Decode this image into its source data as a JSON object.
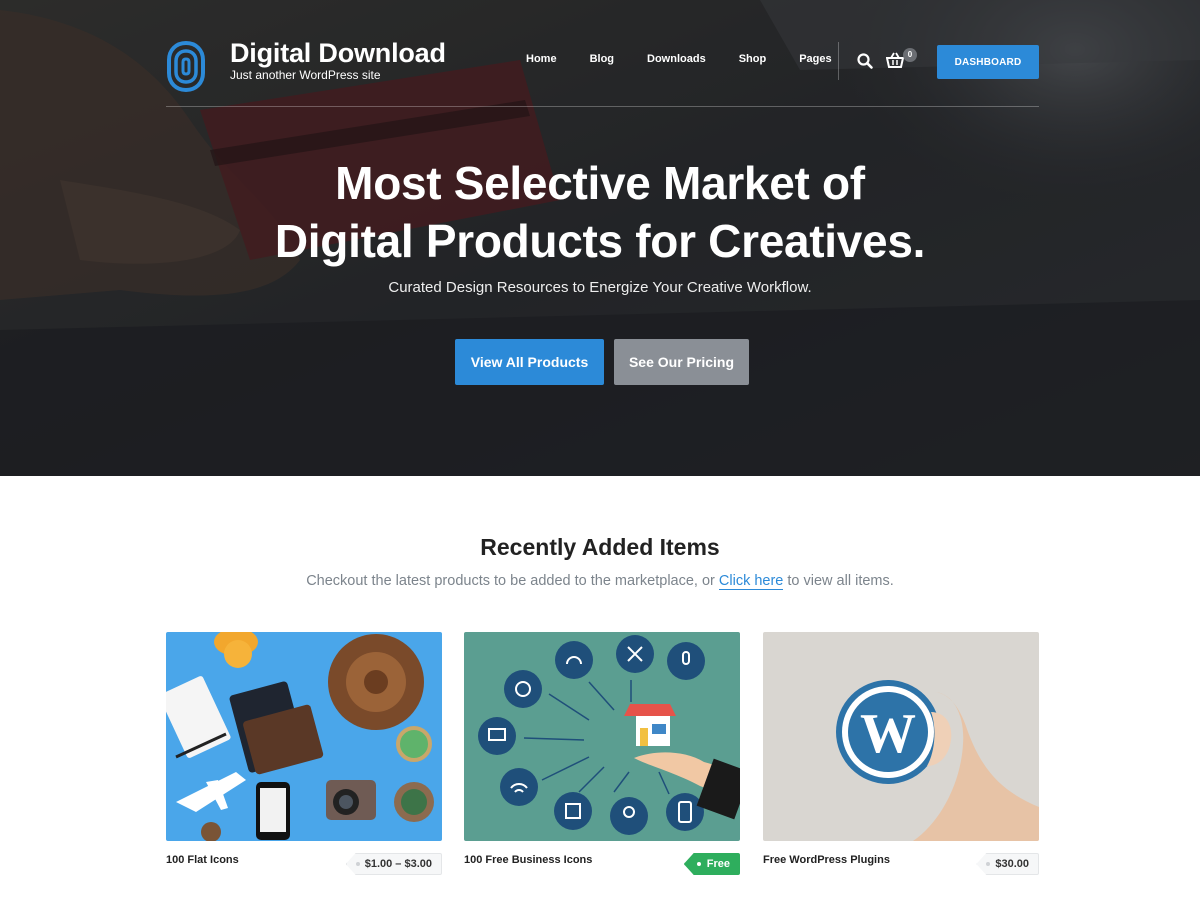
{
  "brand": {
    "title": "Digital Download",
    "tagline": "Just another WordPress site"
  },
  "nav": {
    "items": [
      {
        "label": "Home"
      },
      {
        "label": "Blog"
      },
      {
        "label": "Downloads"
      },
      {
        "label": "Shop"
      },
      {
        "label": "Pages"
      }
    ],
    "cart_count": "0",
    "dashboard_label": "DASHBOARD"
  },
  "hero": {
    "title_line1": "Most Selective Market of",
    "title_line2": "Digital Products for Creatives.",
    "subtitle": "Curated Design Resources to Energize Your Creative Workflow.",
    "primary_button": "View All Products",
    "secondary_button": "See Our Pricing"
  },
  "recent": {
    "title": "Recently Added Items",
    "subtitle_before": "Checkout the latest products to be added to the marketplace, or ",
    "subtitle_link": "Click here",
    "subtitle_after": " to view all items.",
    "products": [
      {
        "title": "100 Flat Icons",
        "price": "$1.00 – $3.00"
      },
      {
        "title": "100 Free Business Icons",
        "price": "Free"
      },
      {
        "title": "Free WordPress Plugins",
        "price": "$30.00"
      }
    ]
  },
  "colors": {
    "accent": "#2c8ad8",
    "secondary_button": "#8a8f96",
    "free_badge": "#2eae5d",
    "hero_bg": "#2b2d31"
  },
  "icons": {
    "logo": "fingerprint-logo-icon",
    "search": "search-icon",
    "cart": "cart-icon"
  }
}
